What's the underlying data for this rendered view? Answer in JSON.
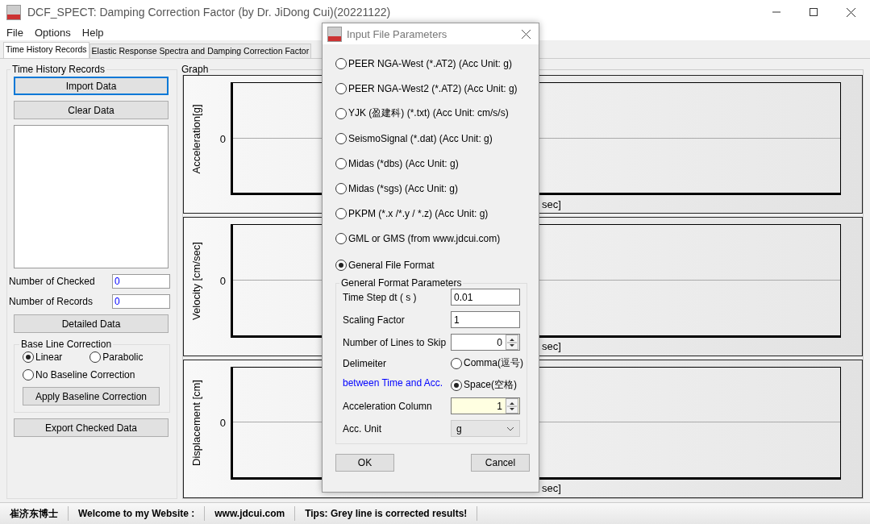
{
  "window": {
    "title": "DCF_SPECT: Damping Correction Factor (by Dr. JiDong Cui)(20221122)"
  },
  "menu": [
    "File",
    "Options",
    "Help"
  ],
  "tabs": [
    {
      "label": "Time History Records",
      "selected": true
    },
    {
      "label": "Elastic Response Spectra and Damping Correction Factor",
      "selected": false
    }
  ],
  "records": {
    "title": "Time History Records",
    "import_button": {
      "label": "Import Data",
      "focused": true
    },
    "clear_button": {
      "label": "Clear Data",
      "focused": false
    },
    "counts": [
      {
        "label": "Number of Checked",
        "value": "0"
      },
      {
        "label": "Number of Records",
        "value": "0"
      }
    ],
    "detail_button": {
      "label": "Detailed Data",
      "focused": false
    },
    "baseline": {
      "title": "Base Line Correction",
      "options": [
        {
          "label": "Linear",
          "selected": true
        },
        {
          "label": "Parabolic",
          "selected": false
        },
        {
          "label": "No Baseline Correction",
          "selected": false
        }
      ],
      "apply_button": {
        "label": "Apply Baseline Correction",
        "focused": false
      }
    },
    "export_button": {
      "label": "Export Checked Data",
      "focused": false
    }
  },
  "graph": {
    "title": "Graph",
    "plots": [
      {
        "ylabel": "Acceleration[g]",
        "ytick": "0",
        "xlabel": "sec]"
      },
      {
        "ylabel": "Velocity [cm/sec]",
        "ytick": "0",
        "xlabel": "sec]"
      },
      {
        "ylabel": "Displacement [cm]",
        "ytick": "0",
        "xlabel": "sec]"
      }
    ]
  },
  "status_bar": [
    "崔济东博士",
    "Welcome to my Website :",
    "www.jdcui.com",
    "Tips: Grey line is corrected results!"
  ],
  "dialog": {
    "title": "Input File Parameters",
    "formats": [
      {
        "label": "PEER NGA-West (*.AT2) (Acc Unit: g)",
        "selected": false
      },
      {
        "label": "PEER NGA-West2 (*.AT2) (Acc Unit: g)",
        "selected": false
      },
      {
        "label": "YJK (盈建科) (*.txt) (Acc Unit: cm/s/s)",
        "selected": false
      },
      {
        "label": "SeismoSignal (*.dat) (Acc Unit: g)",
        "selected": false
      },
      {
        "label": "Midas (*dbs) (Acc Unit: g)",
        "selected": false
      },
      {
        "label": "Midas (*sgs) (Acc Unit: g)",
        "selected": false
      },
      {
        "label": "PKPM (*.x /*.y / *.z) (Acc Unit: g)",
        "selected": false
      },
      {
        "label": "GML or GMS (from www.jdcui.com)",
        "selected": false
      },
      {
        "label": "General File Format",
        "selected": true
      }
    ],
    "params": {
      "title": "General Format Parameters",
      "time_step": {
        "label": "Time Step dt ( s )",
        "value": "0.01"
      },
      "scaling": {
        "label": "Scaling Factor",
        "value": "1"
      },
      "skip": {
        "label": "Number of Lines to Skip",
        "value": "0"
      },
      "delimiter": {
        "label": "Delimeiter",
        "note": "between Time and Acc.",
        "options": [
          {
            "label": "Comma(逗号)",
            "selected": false
          },
          {
            "label": "Space(空格)",
            "selected": true
          }
        ]
      },
      "column": {
        "label": "Acceleration Column",
        "value": "1"
      },
      "unit": {
        "label": "Acc. Unit",
        "value": "g"
      }
    },
    "buttons": [
      "OK",
      "Cancel"
    ]
  }
}
